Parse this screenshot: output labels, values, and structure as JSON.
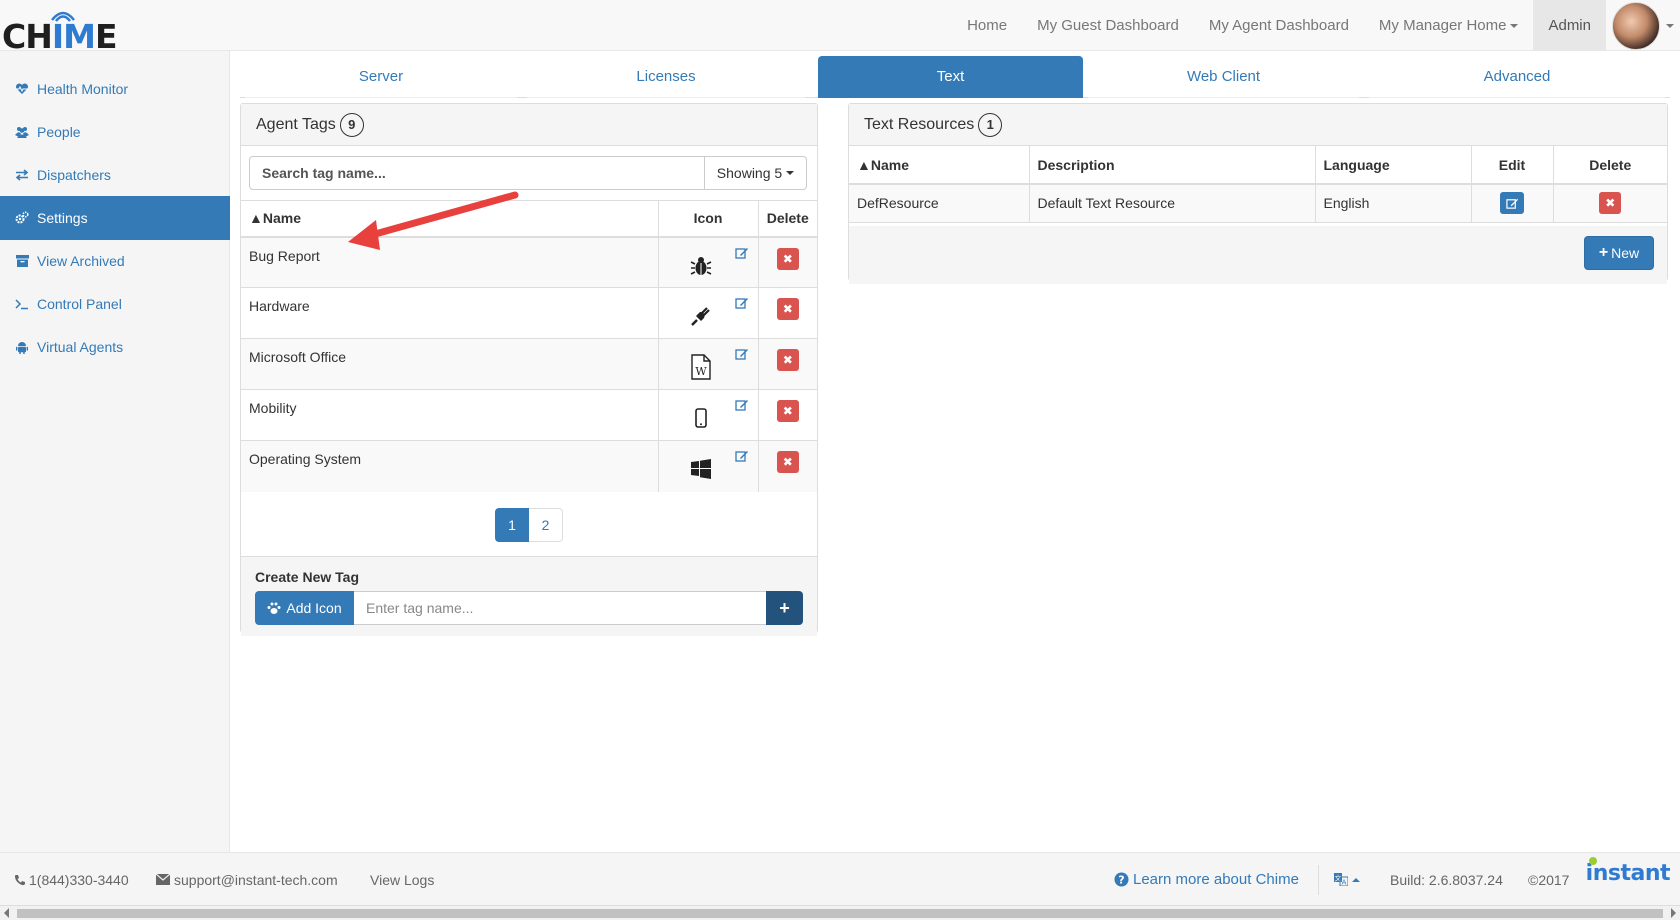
{
  "brand": {
    "logo_text_black1": "CH",
    "logo_text_blue": "IM",
    "logo_text_black2": "E"
  },
  "topnav": {
    "items": [
      {
        "label": "Home"
      },
      {
        "label": "My Guest Dashboard"
      },
      {
        "label": "My Agent Dashboard"
      },
      {
        "label": "My Manager Home"
      },
      {
        "label": "Admin"
      }
    ]
  },
  "sidebar": {
    "items": [
      {
        "label": "Health Monitor",
        "icon": "heartbeat-icon"
      },
      {
        "label": "People",
        "icon": "users-icon"
      },
      {
        "label": "Dispatchers",
        "icon": "exchange-icon"
      },
      {
        "label": "Settings",
        "icon": "cogs-icon"
      },
      {
        "label": "View Archived",
        "icon": "archive-icon"
      },
      {
        "label": "Control Panel",
        "icon": "terminal-icon"
      },
      {
        "label": "Virtual Agents",
        "icon": "android-icon"
      }
    ],
    "active_index": 3
  },
  "tabs": [
    {
      "label": "Server"
    },
    {
      "label": "Licenses"
    },
    {
      "label": "Text"
    },
    {
      "label": "Web Client"
    },
    {
      "label": "Advanced"
    }
  ],
  "agent_tags": {
    "title": "Agent Tags",
    "count": "9",
    "search_placeholder": "Search tag name...",
    "showing_label": "Showing 5",
    "columns": {
      "name": "▲Name",
      "icon": "Icon",
      "delete": "Delete"
    },
    "rows": [
      {
        "name": "Bug Report",
        "icon": "bug-icon"
      },
      {
        "name": "Hardware",
        "icon": "plug-icon"
      },
      {
        "name": "Microsoft Office",
        "icon": "word-file-icon"
      },
      {
        "name": "Mobility",
        "icon": "mobile-phone-icon"
      },
      {
        "name": "Operating System",
        "icon": "windows-icon"
      }
    ],
    "pages": [
      "1",
      "2"
    ],
    "current_page": "1",
    "create_title": "Create New Tag",
    "add_icon_label": "Add Icon",
    "tag_name_placeholder": "Enter tag name..."
  },
  "text_resources": {
    "title": "Text Resources",
    "count": "1",
    "columns": {
      "name": "▲Name",
      "description": "Description",
      "language": "Language",
      "edit": "Edit",
      "delete": "Delete"
    },
    "rows": [
      {
        "name": "DefResource",
        "description": "Default Text Resource",
        "language": "English"
      }
    ],
    "new_label": "New"
  },
  "footer": {
    "phone": "1(844)330-3440",
    "email": "support@instant-tech.com",
    "view_logs": "View Logs",
    "learn_more": "Learn more about Chime",
    "build": "Build: 2.6.8037.24",
    "copyright": "©2017",
    "company_logo": "instant"
  },
  "colors": {
    "primary": "#337ab7",
    "danger": "#d9534f",
    "annotation": "#e8403d"
  }
}
